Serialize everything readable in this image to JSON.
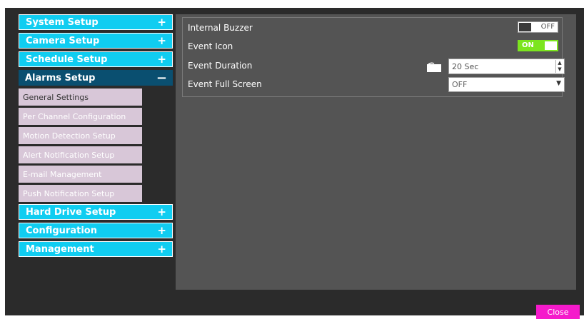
{
  "sidebar": {
    "categories_top": [
      {
        "label": "System Setup",
        "icon": "+"
      },
      {
        "label": "Camera Setup",
        "icon": "+"
      },
      {
        "label": "Schedule Setup",
        "icon": "+"
      }
    ],
    "active_category": {
      "label": "Alarms Setup",
      "icon": "−"
    },
    "sub_items": [
      "General Settings",
      "Per Channel Configuration",
      "Motion Detection Setup",
      "Alert Notification Setup",
      "E-mail Management",
      "Push Notification Setup"
    ],
    "categories_bottom": [
      {
        "label": "Hard Drive Setup",
        "icon": "+"
      },
      {
        "label": "Configuration",
        "icon": "+"
      },
      {
        "label": "Management",
        "icon": "+"
      }
    ]
  },
  "settings": {
    "internal_buzzer": {
      "label": "Internal Buzzer",
      "state": "OFF"
    },
    "event_icon": {
      "label": "Event Icon",
      "state": "ON"
    },
    "event_duration": {
      "label": "Event Duration",
      "value": "20 Sec"
    },
    "event_full_screen": {
      "label": "Event Full Screen",
      "value": "OFF"
    }
  },
  "footer": {
    "close_label": "Close"
  },
  "colors": {
    "category_bg": "#10cdf1",
    "active_category_bg": "#0a4f70",
    "sub_item_bg": "#d8c7d8",
    "toggle_on": "#7ce51f",
    "close_button": "#f51acb"
  },
  "icons": {
    "expand": "plus-icon",
    "collapse": "minus-icon",
    "duration": "keyboard-icon",
    "spinner": "spinner-arrows-icon",
    "dropdown": "chevron-down-icon"
  }
}
